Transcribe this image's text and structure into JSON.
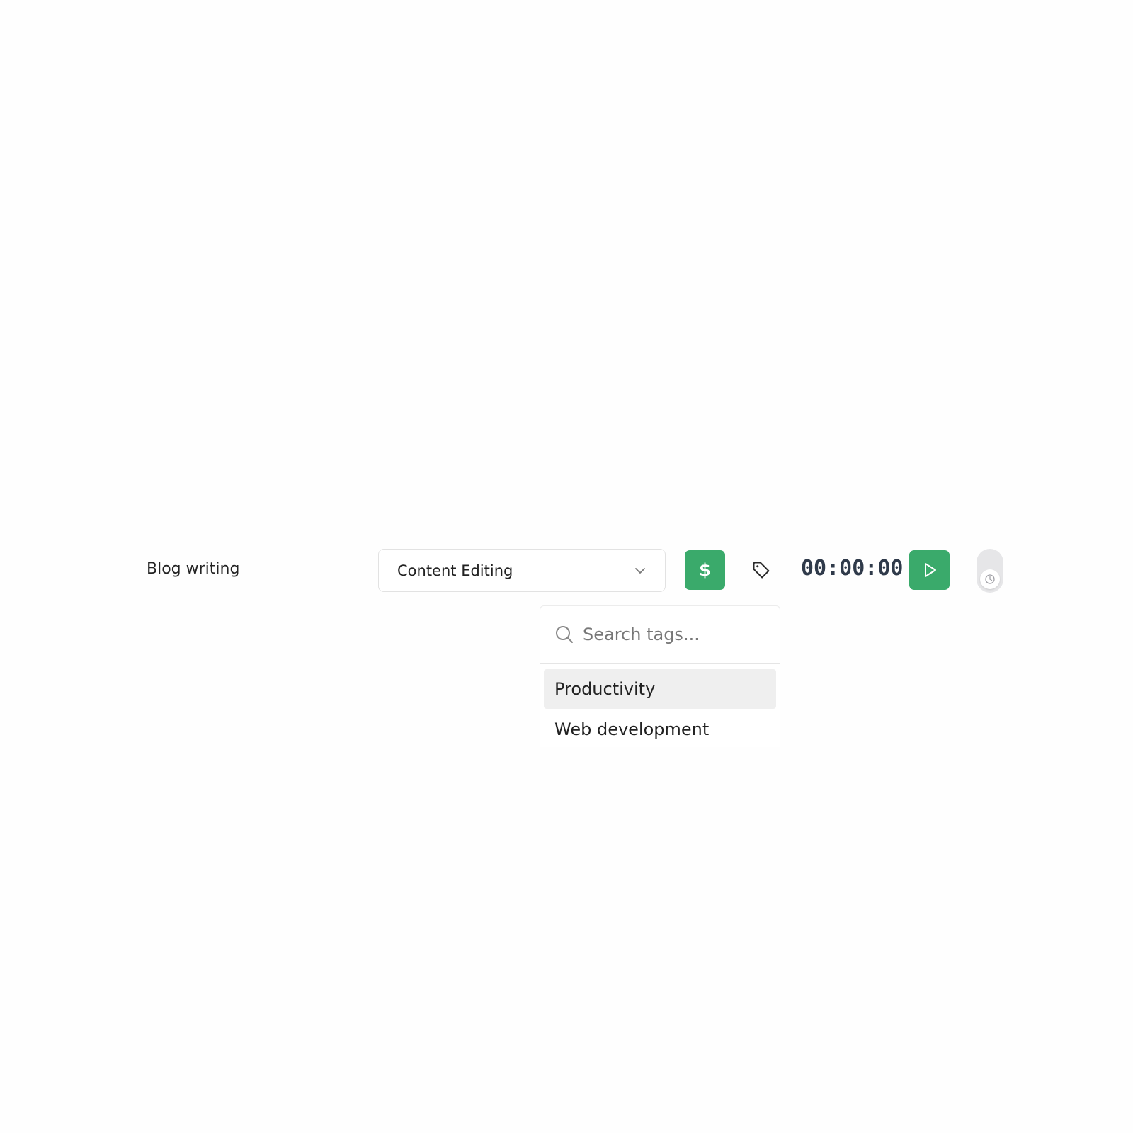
{
  "entry": {
    "description": "Blog writing",
    "project": "Content Editing",
    "timer": "00:00:00"
  },
  "icons": {
    "project_chevron": "chevron-down-icon",
    "billable": "dollar-icon",
    "tag": "tag-icon",
    "play": "play-icon",
    "mode": "clock-icon",
    "search": "search-icon"
  },
  "billable_symbol": "$",
  "tag_dropdown": {
    "search_placeholder": "Search tags...",
    "items": [
      {
        "label": "Productivity",
        "highlighted": true
      },
      {
        "label": "Web development",
        "highlighted": false
      }
    ]
  },
  "colors": {
    "accent_green": "#3aaa6b",
    "timer_text": "#2f3a4a",
    "toggle_bg": "#e6e6e8",
    "highlight_bg": "#efefef"
  }
}
